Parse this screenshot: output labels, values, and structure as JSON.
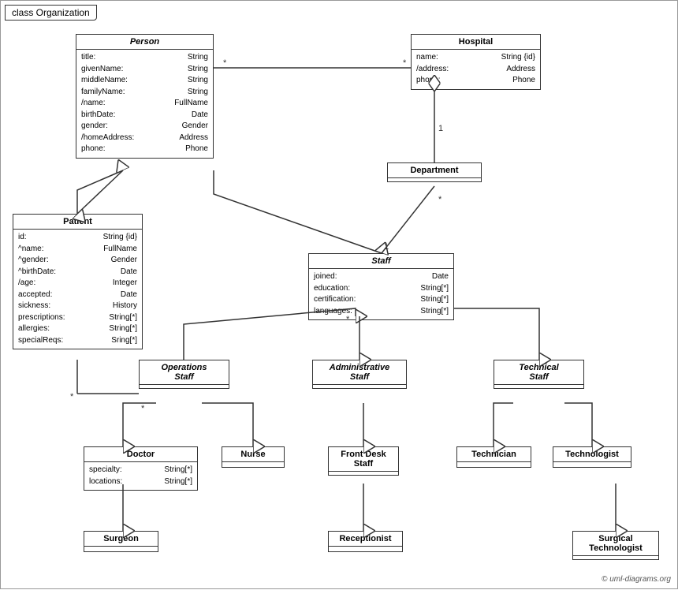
{
  "title": "class Organization",
  "classes": {
    "person": {
      "name": "Person",
      "italic": true,
      "attrs": [
        {
          "name": "title:",
          "type": "String"
        },
        {
          "name": "givenName:",
          "type": "String"
        },
        {
          "name": "middleName:",
          "type": "String"
        },
        {
          "name": "familyName:",
          "type": "String"
        },
        {
          "name": "/name:",
          "type": "FullName"
        },
        {
          "name": "birthDate:",
          "type": "Date"
        },
        {
          "name": "gender:",
          "type": "Gender"
        },
        {
          "name": "/homeAddress:",
          "type": "Address"
        },
        {
          "name": "phone:",
          "type": "Phone"
        }
      ]
    },
    "hospital": {
      "name": "Hospital",
      "italic": false,
      "attrs": [
        {
          "name": "name:",
          "type": "String {id}"
        },
        {
          "name": "/address:",
          "type": "Address"
        },
        {
          "name": "phone:",
          "type": "Phone"
        }
      ]
    },
    "patient": {
      "name": "Patient",
      "italic": false,
      "attrs": [
        {
          "name": "id:",
          "type": "String {id}"
        },
        {
          "name": "^name:",
          "type": "FullName"
        },
        {
          "name": "^gender:",
          "type": "Gender"
        },
        {
          "name": "^birthDate:",
          "type": "Date"
        },
        {
          "name": "/age:",
          "type": "Integer"
        },
        {
          "name": "accepted:",
          "type": "Date"
        },
        {
          "name": "sickness:",
          "type": "History"
        },
        {
          "name": "prescriptions:",
          "type": "String[*]"
        },
        {
          "name": "allergies:",
          "type": "String[*]"
        },
        {
          "name": "specialReqs:",
          "type": "Sring[*]"
        }
      ]
    },
    "department": {
      "name": "Department",
      "italic": false,
      "attrs": []
    },
    "staff": {
      "name": "Staff",
      "italic": true,
      "attrs": [
        {
          "name": "joined:",
          "type": "Date"
        },
        {
          "name": "education:",
          "type": "String[*]"
        },
        {
          "name": "certification:",
          "type": "String[*]"
        },
        {
          "name": "languages:",
          "type": "String[*]"
        }
      ]
    },
    "operations_staff": {
      "name": "Operations Staff",
      "italic": true,
      "attrs": []
    },
    "administrative_staff": {
      "name": "Administrative Staff",
      "italic": true,
      "attrs": []
    },
    "technical_staff": {
      "name": "Technical Staff",
      "italic": true,
      "attrs": []
    },
    "doctor": {
      "name": "Doctor",
      "italic": false,
      "attrs": [
        {
          "name": "specialty:",
          "type": "String[*]"
        },
        {
          "name": "locations:",
          "type": "String[*]"
        }
      ]
    },
    "nurse": {
      "name": "Nurse",
      "italic": false,
      "attrs": []
    },
    "front_desk_staff": {
      "name": "Front Desk Staff",
      "italic": false,
      "attrs": []
    },
    "technician": {
      "name": "Technician",
      "italic": false,
      "attrs": []
    },
    "technologist": {
      "name": "Technologist",
      "italic": false,
      "attrs": []
    },
    "surgeon": {
      "name": "Surgeon",
      "italic": false,
      "attrs": []
    },
    "receptionist": {
      "name": "Receptionist",
      "italic": false,
      "attrs": []
    },
    "surgical_technologist": {
      "name": "Surgical Technologist",
      "italic": false,
      "attrs": []
    }
  },
  "copyright": "© uml-diagrams.org"
}
